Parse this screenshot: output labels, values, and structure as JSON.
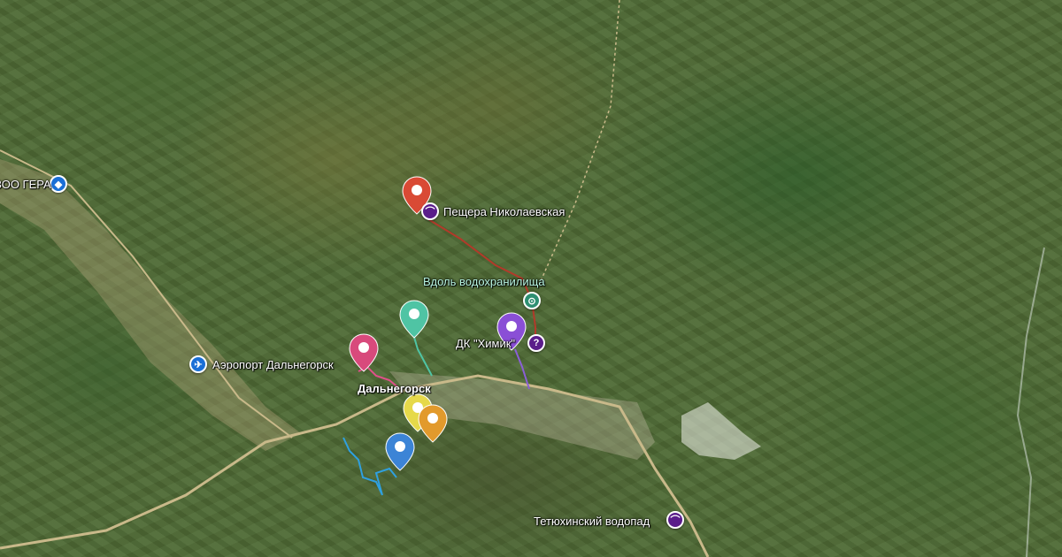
{
  "map": {
    "view": "satellite",
    "labels": {
      "cave": "Пещера Николаевская",
      "reservoir": "Вдоль водохранилища",
      "dk": "ДК \"Химик\"",
      "airport": "Аэропорт Дальнегорск",
      "city": "Дальнегорск",
      "waterfall": "Тетюхинский водопад",
      "zoo": "ЗОО ГЕРА"
    },
    "icons": {
      "cave": "cave-icon",
      "reservoir": "waypoint-icon",
      "dk": "question-icon",
      "airport": "airplane-icon",
      "waterfall": "cave-icon",
      "zoo": "pet-icon"
    },
    "pin_colors": {
      "red": "#d94a35",
      "teal": "#4fc4a4",
      "purple": "#8a4fd6",
      "pink": "#d84a7c",
      "yellow": "#e6d94a",
      "orange": "#e29a2c",
      "blue": "#3c84d6"
    },
    "route_colors": {
      "red": "#b23a2a",
      "teal": "#4fc4a4",
      "purple": "#8a5fd6",
      "pink": "#e0508a",
      "blue": "#2fa0e0",
      "road": "#c9b98a"
    }
  }
}
